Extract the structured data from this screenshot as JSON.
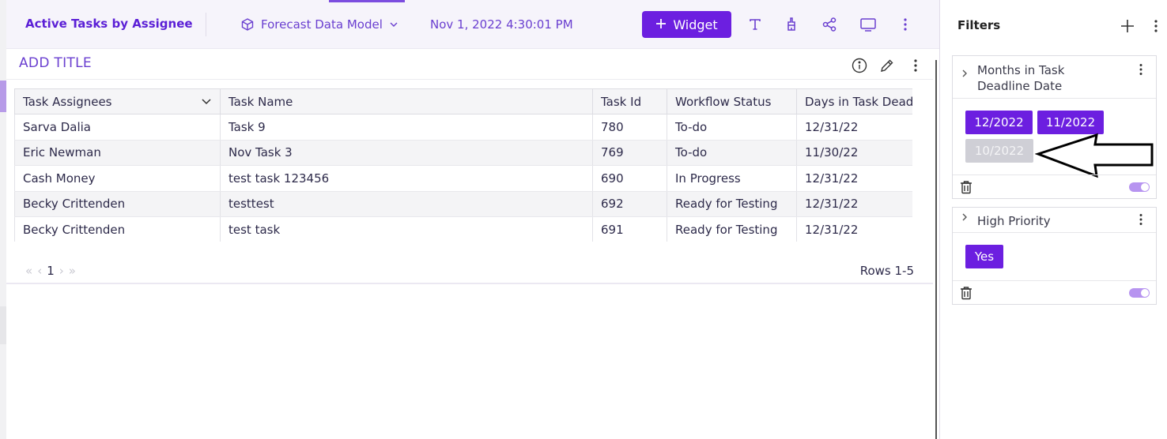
{
  "header": {
    "dashboard_title": "Active Tasks by Assignee",
    "data_model": "Forecast Data Model",
    "datetime": "Nov 1, 2022 4:30:01 PM",
    "widget_button_label": "Widget"
  },
  "widget": {
    "title": "ADD TITLE",
    "table": {
      "columns": [
        "Task Assignees",
        "Task Name",
        "Task Id",
        "Workflow Status",
        "Days in Task Deadline"
      ],
      "rows": [
        [
          "Sarva Dalia",
          "Task 9",
          "780",
          "To-do",
          "12/31/22"
        ],
        [
          "Eric Newman",
          "Nov Task 3",
          "769",
          "To-do",
          "11/30/22"
        ],
        [
          "Cash Money",
          "test task 123456",
          "690",
          "In Progress",
          "12/31/22"
        ],
        [
          "Becky Crittenden",
          "testtest",
          "692",
          "Ready for Testing",
          "12/31/22"
        ],
        [
          "Becky Crittenden",
          "test task",
          "691",
          "Ready for Testing",
          "12/31/22"
        ]
      ]
    },
    "pagination": {
      "current_page": "1",
      "rows_info": "Rows 1-5"
    }
  },
  "filters": {
    "title": "Filters",
    "cards": [
      {
        "title": "Months in Task Deadline Date",
        "chips": [
          {
            "label": "12/2022",
            "selected": true
          },
          {
            "label": "11/2022",
            "selected": true
          },
          {
            "label": "10/2022",
            "selected": false
          }
        ]
      },
      {
        "title": "High Priority",
        "chips": [
          {
            "label": "Yes",
            "selected": true
          }
        ]
      }
    ]
  },
  "colors": {
    "accent": "#6c1fe0",
    "accent_text": "#6a3fd0",
    "chip_off": "#cfcfd6",
    "toggle": "#b794f0"
  }
}
